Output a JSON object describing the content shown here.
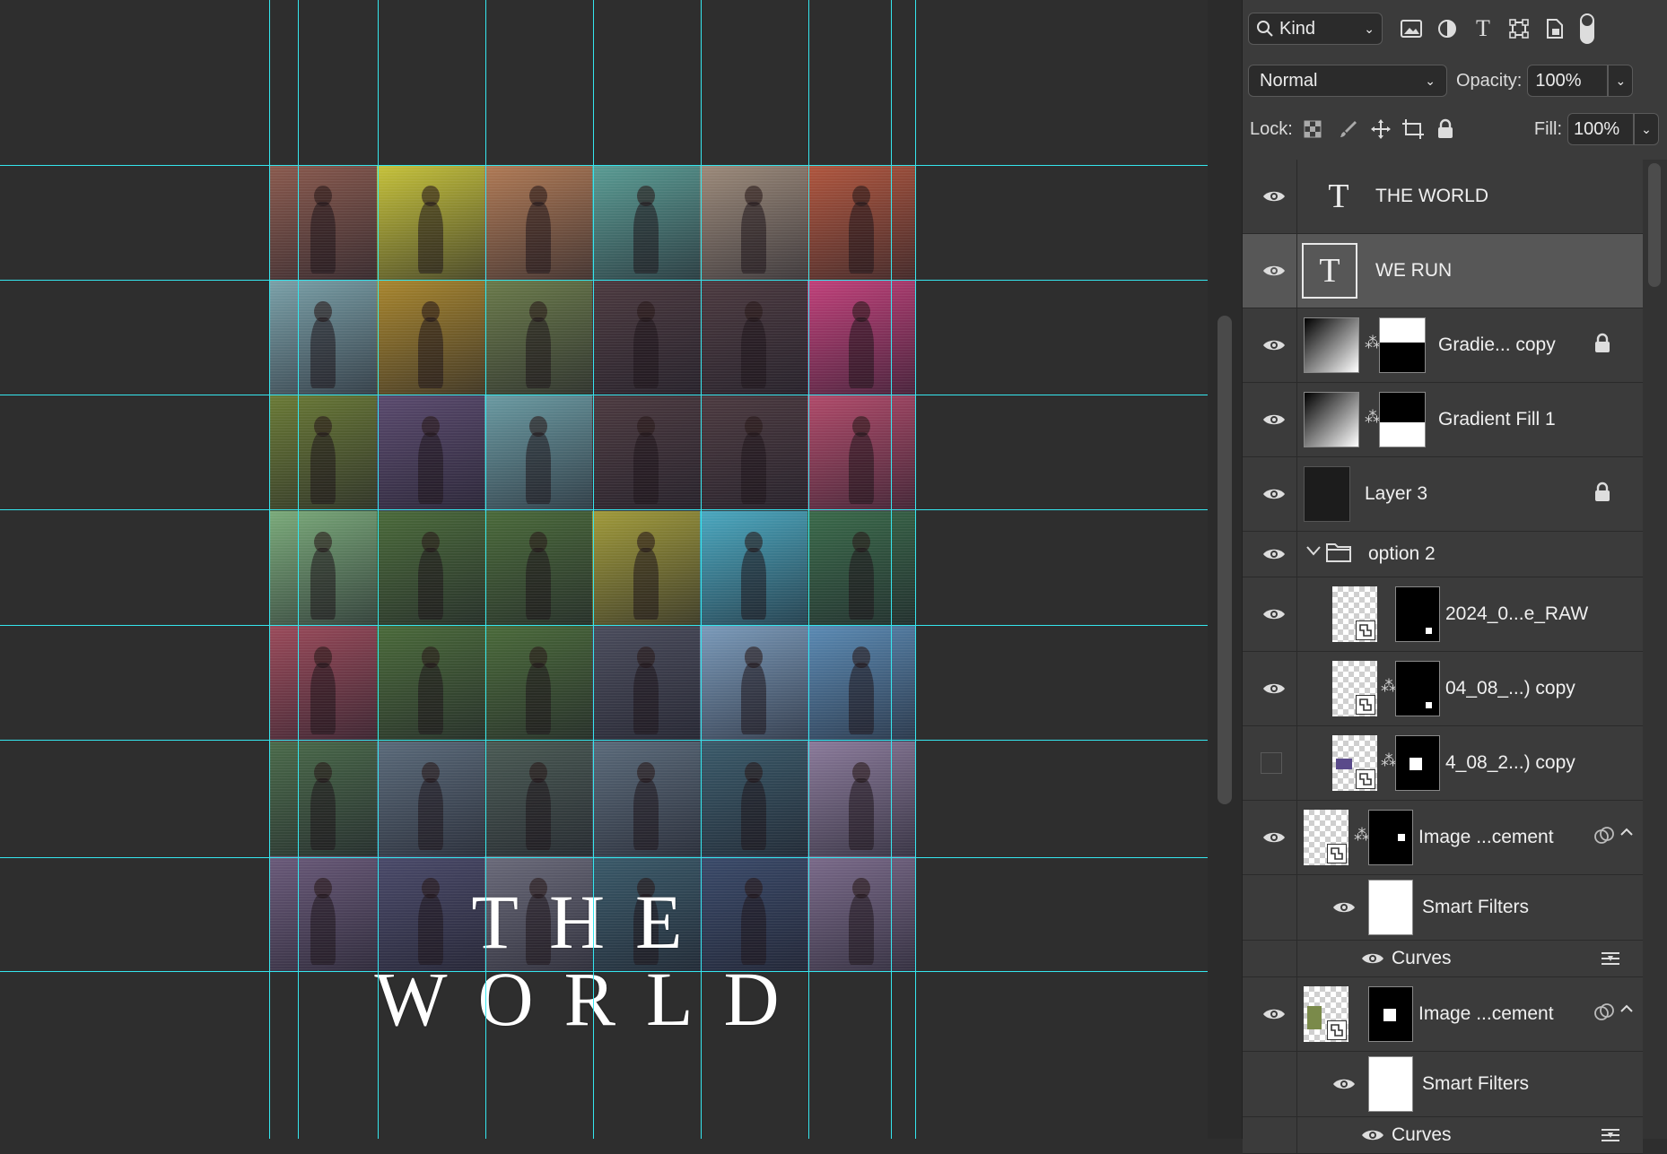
{
  "canvas": {
    "title_text": "THE WORLD",
    "tiles": [
      {
        "c": "#8a5a4e"
      },
      {
        "c": "#c6c23a"
      },
      {
        "c": "#b07a55"
      },
      {
        "c": "#5a9c94"
      },
      {
        "c": "#9c8a7a"
      },
      {
        "c": "#b0563e"
      },
      {
        "c": "#7aa0a8"
      },
      {
        "c": "#a8862e"
      },
      {
        "c": "#6a7a4a"
      },
      {
        "c": "#4c3a40"
      },
      {
        "c": "#4c3a40"
      },
      {
        "c": "#c0407a"
      },
      {
        "c": "#6a7a36"
      },
      {
        "c": "#5a4a6e"
      },
      {
        "c": "#6a9aa2"
      },
      {
        "c": "#4c3a40"
      },
      {
        "c": "#4c3a40"
      },
      {
        "c": "#b04a6a"
      },
      {
        "c": "#7aaa7a"
      },
      {
        "c": "#4a6a3a"
      },
      {
        "c": "#4a6a3a"
      },
      {
        "c": "#a09a3a"
      },
      {
        "c": "#4aa8c0"
      },
      {
        "c": "#3a6a4a"
      },
      {
        "c": "#9a4a5a"
      },
      {
        "c": "#4a6a3a"
      },
      {
        "c": "#4a6a3a"
      },
      {
        "c": "#4a4c5c"
      },
      {
        "c": "#7a9aba"
      },
      {
        "c": "#5a8ab4"
      },
      {
        "c": "#4a6a4a"
      },
      {
        "c": "#5a6a7a"
      },
      {
        "c": "#4a5a54"
      },
      {
        "c": "#5a6a7a"
      },
      {
        "c": "#3a5a6a"
      },
      {
        "c": "#8a7a9a"
      },
      {
        "c": "#6a5a7a"
      },
      {
        "c": "#4a4a6a"
      },
      {
        "c": "#6a6a7a"
      },
      {
        "c": "#3a5a6a"
      },
      {
        "c": "#3a4a6a"
      },
      {
        "c": "#7a6a8a"
      }
    ]
  },
  "toolbar": {
    "kind_label": "Kind",
    "blend_mode": "Normal",
    "opacity_label": "Opacity:",
    "opacity_value": "100%",
    "lock_label": "Lock:",
    "fill_label": "Fill:",
    "fill_value": "100%"
  },
  "layers": [
    {
      "name": "THE WORLD",
      "type": "text",
      "visible": true
    },
    {
      "name": "WE RUN",
      "type": "text",
      "visible": true,
      "selected": true
    },
    {
      "name": "Gradie... copy",
      "type": "gradient",
      "visible": true,
      "locked": true
    },
    {
      "name": "Gradient Fill 1",
      "type": "gradient",
      "visible": true
    },
    {
      "name": "Layer 3",
      "type": "pixel",
      "visible": true,
      "locked": true
    },
    {
      "name": "option 2",
      "type": "group",
      "visible": true
    },
    {
      "name": "2024_0...e_RAW",
      "type": "smart",
      "visible": true
    },
    {
      "name": "04_08_...) copy",
      "type": "smart",
      "visible": true
    },
    {
      "name": "4_08_2...) copy",
      "type": "smart",
      "visible": false
    },
    {
      "name": "Image ...cement",
      "type": "smart",
      "visible": true
    },
    {
      "name": "Smart Filters",
      "type": "filters",
      "visible": true
    },
    {
      "name": "Curves",
      "type": "curves",
      "visible": true
    },
    {
      "name": "Image ...cement",
      "type": "smart",
      "visible": true
    },
    {
      "name": "Smart Filters",
      "type": "filters",
      "visible": true
    },
    {
      "name": "Curves",
      "type": "curves",
      "visible": true
    }
  ]
}
